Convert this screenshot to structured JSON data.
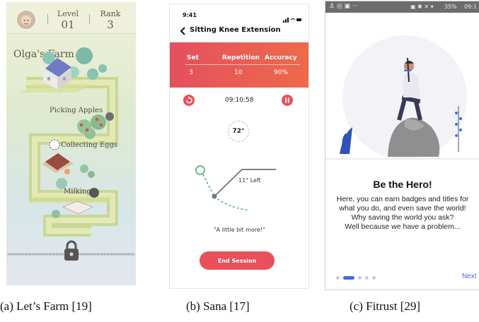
{
  "captions": {
    "a": "(a) Let’s Farm [19]",
    "b": "(b) Sana [17]",
    "c": "(c) Fitrust [29]"
  },
  "farm": {
    "level_label": "Level",
    "level_value": "01",
    "rank_label": "Rank",
    "rank_value": "3",
    "farm_name": "Olga's Farm",
    "tasks": [
      "Picking Apples",
      "Collecting Eggs",
      "Milking"
    ],
    "icons": [
      "avatar",
      "house-icon",
      "apple-tree-icon",
      "hen-icon",
      "cow-icon",
      "lock-icon"
    ]
  },
  "sana": {
    "time": "9:41",
    "title": "Sitting Knee Extension",
    "columns": [
      "Set",
      "Repetition",
      "Accuracy"
    ],
    "values": [
      "3",
      "10",
      "90%"
    ],
    "timer": "09:10:58",
    "angle": "72°",
    "angle_note": "11° Left",
    "encouragement": "\"A little bit more!\"",
    "end_button": "End Session",
    "accent": "#e8505b"
  },
  "fitrust": {
    "status_battery": "35%",
    "status_time": "09:1",
    "heading": "Be the Hero!",
    "body_lines": [
      "Here, you can earn badges and titles for",
      "what you do, and even save the world!",
      "Why saving the world you ask?",
      "Well because we have a problem..."
    ],
    "next_label": "Next",
    "page_count": 5,
    "active_page": 2,
    "accent": "#3d6fe0"
  }
}
